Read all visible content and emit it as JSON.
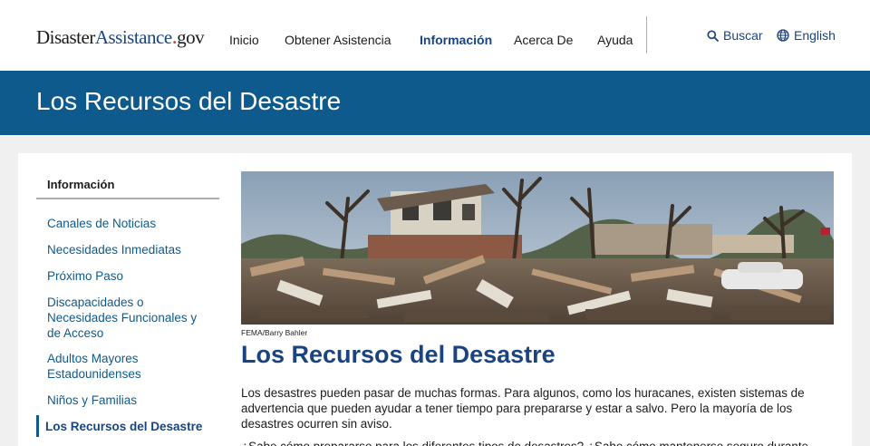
{
  "header": {
    "logo_part1": "Disaster",
    "logo_part2": "Assistance",
    "logo_dot": ".",
    "logo_part3": "gov",
    "nav": [
      "Inicio",
      "Obtener Asistencia",
      "Información",
      "Acerca De",
      "Ayuda"
    ],
    "nav_active": "Información",
    "search_label": "Buscar",
    "language_label": "English"
  },
  "banner": {
    "title": "Los Recursos del Desastre"
  },
  "sidebar": {
    "title": "Información",
    "items": [
      "Canales de Noticias",
      "Necesidades Inmediatas",
      "Próximo Paso",
      "Discapacidades o Necesidades Funcionales y de Acceso",
      "Adultos Mayores Estadounidenses",
      "Niños y Familias",
      "Los Recursos del Desastre"
    ],
    "current": "Los Recursos del Desastre"
  },
  "main": {
    "image_caption": "FEMA/Barry Bahler",
    "title": "Los Recursos del Desastre",
    "paragraph1": "Los desastres pueden pasar de muchas formas. Para algunos, como los huracanes, existen sistemas de advertencia que pueden ayudar a tener tiempo para prepararse y estar a salvo. Pero la mayoría de los desastres ocurren sin aviso.",
    "paragraph2": "¿Sabe cómo prepararse para los diferentes tipos de desastres? ¿Sabe cómo mantenerse seguro durante"
  },
  "colors": {
    "brand_blue": "#0f5a8c",
    "link_blue": "#1a4480",
    "logo_red": "#d83933"
  },
  "icons": {
    "search": "search-icon",
    "language": "globe-icon"
  }
}
